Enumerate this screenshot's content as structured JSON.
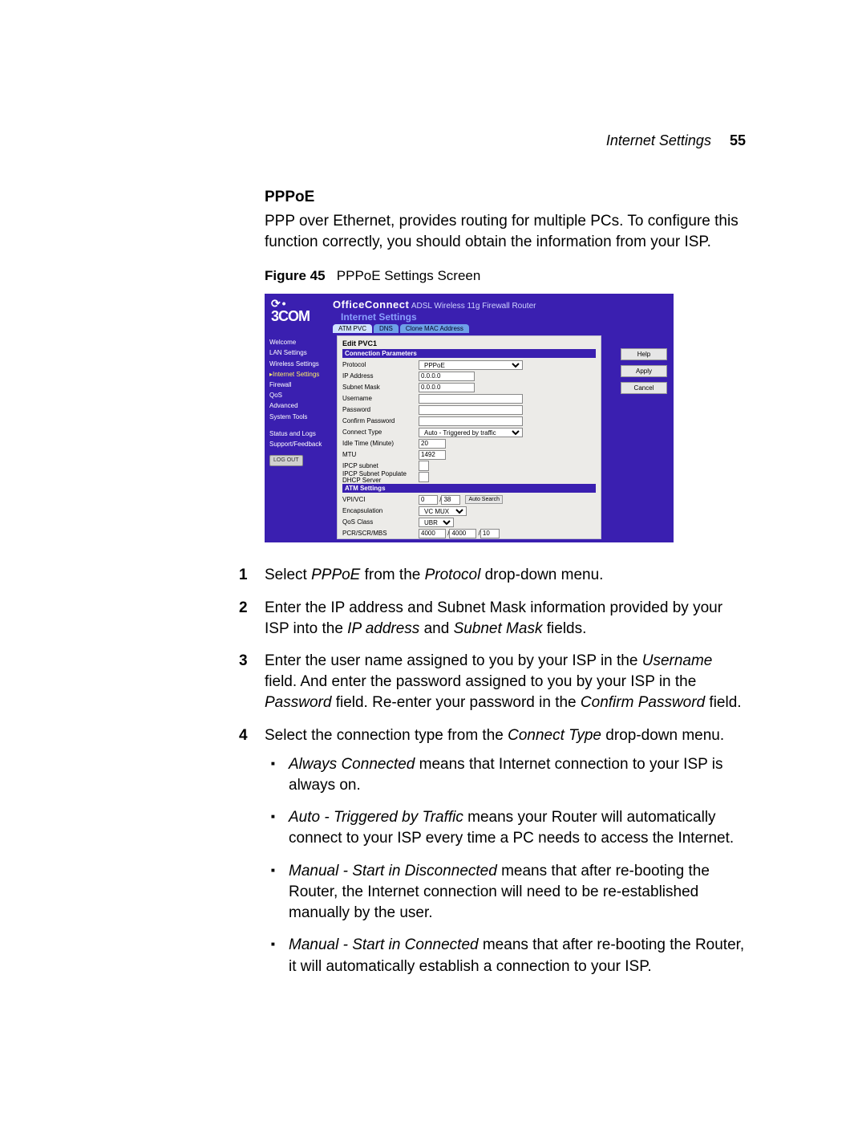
{
  "header": {
    "section": "Internet Settings",
    "page": "55"
  },
  "title": "PPPoE",
  "intro": "PPP over Ethernet, provides routing for multiple PCs. To configure this function correctly, you should obtain the information from your ISP.",
  "figure": {
    "label": "Figure 45",
    "caption": "PPPoE Settings Screen"
  },
  "shot": {
    "logo": "3COM",
    "brand": "OfficeConnect",
    "brand_sub": "ADSL Wireless 11g Firewall Router",
    "section": "Internet Settings",
    "tabs": [
      "ATM PVC",
      "DNS",
      "Clone MAC Address"
    ],
    "sidebar": [
      "Welcome",
      "LAN Settings",
      "Wireless Settings",
      "Internet Settings",
      "Firewall",
      "QoS",
      "Advanced",
      "System Tools",
      "Status and Logs",
      "Support/Feedback"
    ],
    "sidebar_active_index": 3,
    "logout": "LOG OUT",
    "buttons": {
      "help": "Help",
      "apply": "Apply",
      "cancel": "Cancel"
    },
    "panel": {
      "edit": "Edit PVC1",
      "bar1": "Connection Parameters",
      "protocol_lbl": "Protocol",
      "protocol_val": "PPPoE",
      "ip_lbl": "IP Address",
      "ip_val": "0.0.0.0",
      "subnet_lbl": "Subnet Mask",
      "subnet_val": "0.0.0.0",
      "user_lbl": "Username",
      "user_val": "",
      "pass_lbl": "Password",
      "pass_val": "",
      "cpass_lbl": "Confirm Password",
      "cpass_val": "",
      "connect_lbl": "Connect Type",
      "connect_val": "Auto - Triggered by traffic",
      "idle_lbl": "Idle Time (Minute)",
      "idle_val": "20",
      "mtu_lbl": "MTU",
      "mtu_val": "1492",
      "ipcp1_lbl": "IPCP subnet",
      "ipcp2_lbl": "IPCP Subnet Populate DHCP Server",
      "bar2": "ATM Settings",
      "vpivci_lbl": "VPI/VCI",
      "vpi_val": "0",
      "vci_val": "38",
      "autosearch": "Auto Search",
      "encap_lbl": "Encapsulation",
      "encap_val": "VC MUX",
      "qos_lbl": "QoS Class",
      "qos_val": "UBR",
      "pcr_lbl": "PCR/SCR/MBS",
      "pcr_val": "4000",
      "scr_val": "4000",
      "mbs_val": "10"
    }
  },
  "steps": {
    "s1_a": "Select ",
    "s1_i1": "PPPoE",
    "s1_b": " from the ",
    "s1_i2": "Protocol",
    "s1_c": " drop-down menu.",
    "s2_a": "Enter the IP address and Subnet Mask information provided by your ISP into the ",
    "s2_i1": "IP address",
    "s2_b": " and ",
    "s2_i2": "Subnet Mask",
    "s2_c": " fields.",
    "s3_a": "Enter the user name assigned to you by your ISP in the ",
    "s3_i1": "Username",
    "s3_b": " field. And enter the password assigned to you by your ISP in the ",
    "s3_i2": "Password",
    "s3_c": " field. Re-enter your password in the ",
    "s3_i3": "Confirm Password",
    "s3_d": " field.",
    "s4_a": "Select the connection type from the ",
    "s4_i1": "Connect Type",
    "s4_b": " drop-down menu."
  },
  "bullets": {
    "b1_i": "Always Connected",
    "b1_t": " means that Internet connection to your ISP is always on.",
    "b2_i": "Auto - Triggered by Traffic",
    "b2_t": " means your Router will automatically connect to your ISP every time a PC needs to access the Internet.",
    "b3_i": "Manual - Start in Disconnected",
    "b3_t": " means that after re-booting the Router, the Internet connection will need to be re-established manually by the user.",
    "b4_i": "Manual - Start in Connected",
    "b4_t": " means that after re-booting the Router, it will automatically establish a connection to your ISP."
  }
}
